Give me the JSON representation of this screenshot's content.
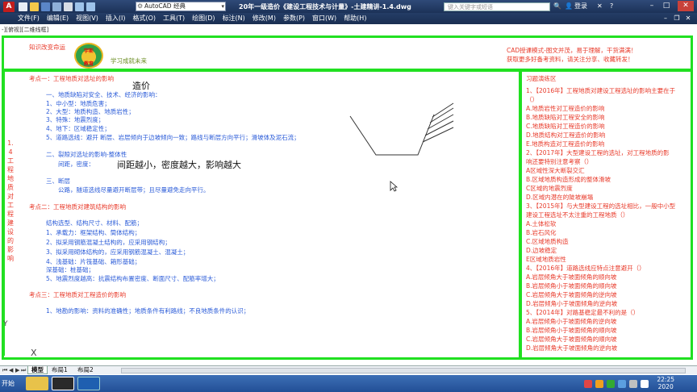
{
  "titlebar": {
    "workspace": "AutoCAD 经典",
    "document_title": "20年一级造价《建设工程技术与计量》-土建精讲-1.4.dwg",
    "help_search_placeholder": "键入关键字或短语",
    "login": "登录",
    "app_logo": "A"
  },
  "menu": {
    "items": [
      "文件(F)",
      "编辑(E)",
      "视图(V)",
      "插入(I)",
      "格式(O)",
      "工具(T)",
      "绘图(D)",
      "标注(N)",
      "修改(M)",
      "参数(P)",
      "窗口(W)",
      "帮助(H)"
    ]
  },
  "viewport": {
    "label": "-][俯视][二维线框]"
  },
  "header": {
    "slogan_left": "知识改变命运",
    "logo_top": "宇斯",
    "logo_bottom": "教育",
    "slogan_right": "学习成就未来",
    "promo_line1": "CAD授课模式-图文并茂，易于理解，干货满满！",
    "promo_line2": "获取更多好备考资料，请关注分享、收藏转发！"
  },
  "vertical_caption": "1.4工程地质对工程建设的影响",
  "notes": {
    "kp1_title": "考点一：工程地质对选址的影响",
    "handwritten_cost": "造价",
    "s1_title": "一、地质缺陷对安全、技术、经济的影响：",
    "s1_items": [
      "1、中小型：地质危害；",
      "2、大型：地质构造、地质岩性；",
      "3、特殊：地震烈度；",
      "4、地下：区域稳定性；",
      "5、道路选线：避开  断层、岩层倾向于边坡倾向一致；路线与断层方向平行；滑坡体及泥石流；"
    ],
    "s2_title": "二、裂隙对选址的影响-整体性",
    "s2_line": "间距，密度：",
    "handwritten_spacing": "间距越小，密度越大，影响越大",
    "s3_title": "三、断层",
    "s3_line": "公路，隧道选线尽量避开断层带；且尽量避免走向平行。",
    "kp2_title": "考点二：工程地质对建筑结构的影响",
    "kp2_intro": "结构选型、结构尺寸、材料、配筋；",
    "kp2_items": [
      "1、承载力：框架结构、筒体结构；",
      "2、拟采用钢筋混凝土结构的，应采用钢结构；",
      "3、拟采用砌体结构的，应采用钢筋混凝土、混凝土；",
      "4、浅基础：片筏基础、箱形基础；",
      "   深基础：桩基础；",
      "5、地震烈度越高：抗震结构布置密度、断面尺寸、配筋率增大；"
    ],
    "kp3_title": "考点三：工程地质对工程造价的影响",
    "kp3_line": "1、地勘的影响：资料的准确性；地质条件有利路线；不良地质条件的认识；"
  },
  "exercise": {
    "title": "习题演练区",
    "lines": [
      "1、【2016年】工程地质对建设工程选址的影响主要在于",
      "（）",
      "A.地质岩性对工程造价的影响",
      "B.地质缺陷对工程安全的影响",
      "C.地质缺陷对工程造价的影响",
      "D.地质结构对工程造价的影响",
      "E.地质构造对工程造价的影响",
      "2、【2017年】大型建设工程的选址，对工程地质的影",
      "响还要特别注意考察（）",
      "A区域性深大断裂交汇",
      "B.区域地质构造形成的整体滑坡",
      "C区域的地震烈度",
      "D.区域内潜在的陡坡崩塌",
      "3、【2015年】与大型建设工程的选址相比，一般中小型",
      "建设工程选址不太注重的工程地质（）",
      "A.土体松软",
      "B.岩石风化",
      "C.区域地质构造",
      "D.边坡稳定",
      "E区域地质岩性",
      "4、【2016年】道路选线应特点注意避开（）",
      "A.岩层倾角大于坡面倾角的顺向坡",
      "B.岩层倾角小于坡面倾角的顺向坡",
      "C.岩层倾角大于坡面倾角的逆向坡",
      "D.岩层倾角小于坡面倾角的逆向坡",
      "5、【2014年】对路基稳定最不利的是（）",
      "A.岩层倾角小于坡面倾角的逆向坡",
      "B.岩层倾角小于坡面倾角的顺向坡",
      "C.岩层倾角大于坡面倾角的顺向坡",
      "D.岩层倾角大于坡面倾角的逆向坡"
    ]
  },
  "ucs": {
    "x_label": "X",
    "y_label": "Y"
  },
  "tabs": {
    "model": "模型",
    "layout1": "布局1",
    "layout2": "布局2"
  },
  "taskbar": {
    "start": "开始",
    "clock_time": "22:25",
    "clock_date": "2020"
  },
  "colors": {
    "frame_green": "#21e021",
    "accent_red": "#e83a2a",
    "accent_blue": "#2a5bd8"
  }
}
